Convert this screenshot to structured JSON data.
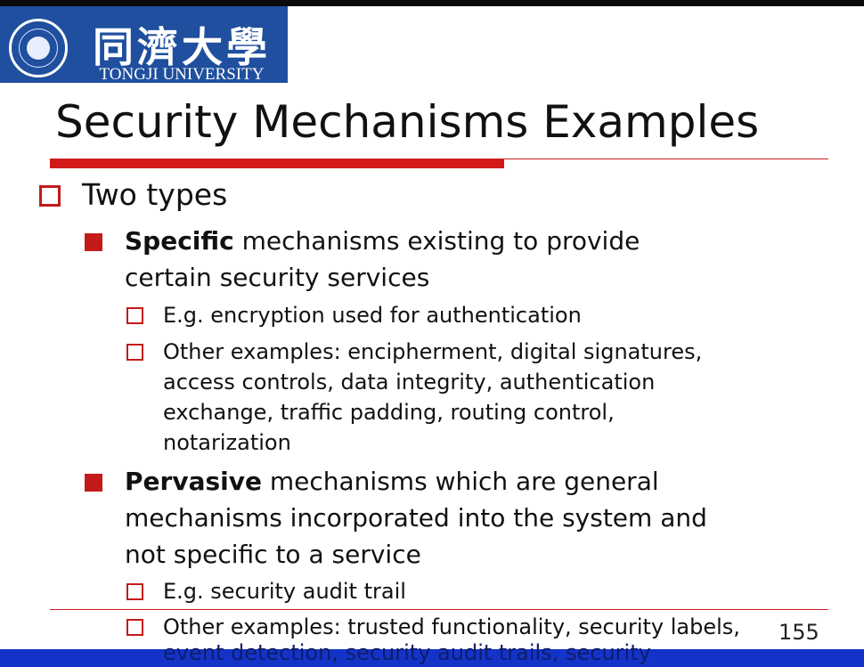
{
  "header": {
    "university_cn": "同濟大學",
    "university_en": "TONGJI UNIVERSITY",
    "colors": {
      "logo_bg": "#1f4f9e",
      "accent_red": "#d21a1a",
      "bottom_bar": "#1433c9"
    }
  },
  "slide": {
    "title": "Security Mechanisms Examples",
    "level1": "Two types",
    "specific": {
      "bold": "Specific",
      "rest_line1": " mechanisms existing to provide",
      "line2": "certain security services",
      "sub1": "E.g. encryption used for authentication",
      "sub2_line1": "Other examples: encipherment, digital signatures,",
      "sub2_line2": "access controls, data integrity, authentication",
      "sub2_line3": "exchange, traffic padding, routing control,",
      "sub2_line4": "notarization"
    },
    "pervasive": {
      "bold": "Pervasive",
      "rest_line1": " mechanisms which are general",
      "line2": "mechanisms incorporated into the system and",
      "line3": "not specific to a service",
      "sub1": "E.g. security audit trail",
      "sub2_line1": "Other examples: trusted functionality, security labels,",
      "sub2_line2": "event detection, security audit trails, security"
    },
    "page_number": "155"
  },
  "icons": [
    "university-seal-icon",
    "hollow-square-bullet-icon",
    "filled-square-bullet-icon"
  ]
}
